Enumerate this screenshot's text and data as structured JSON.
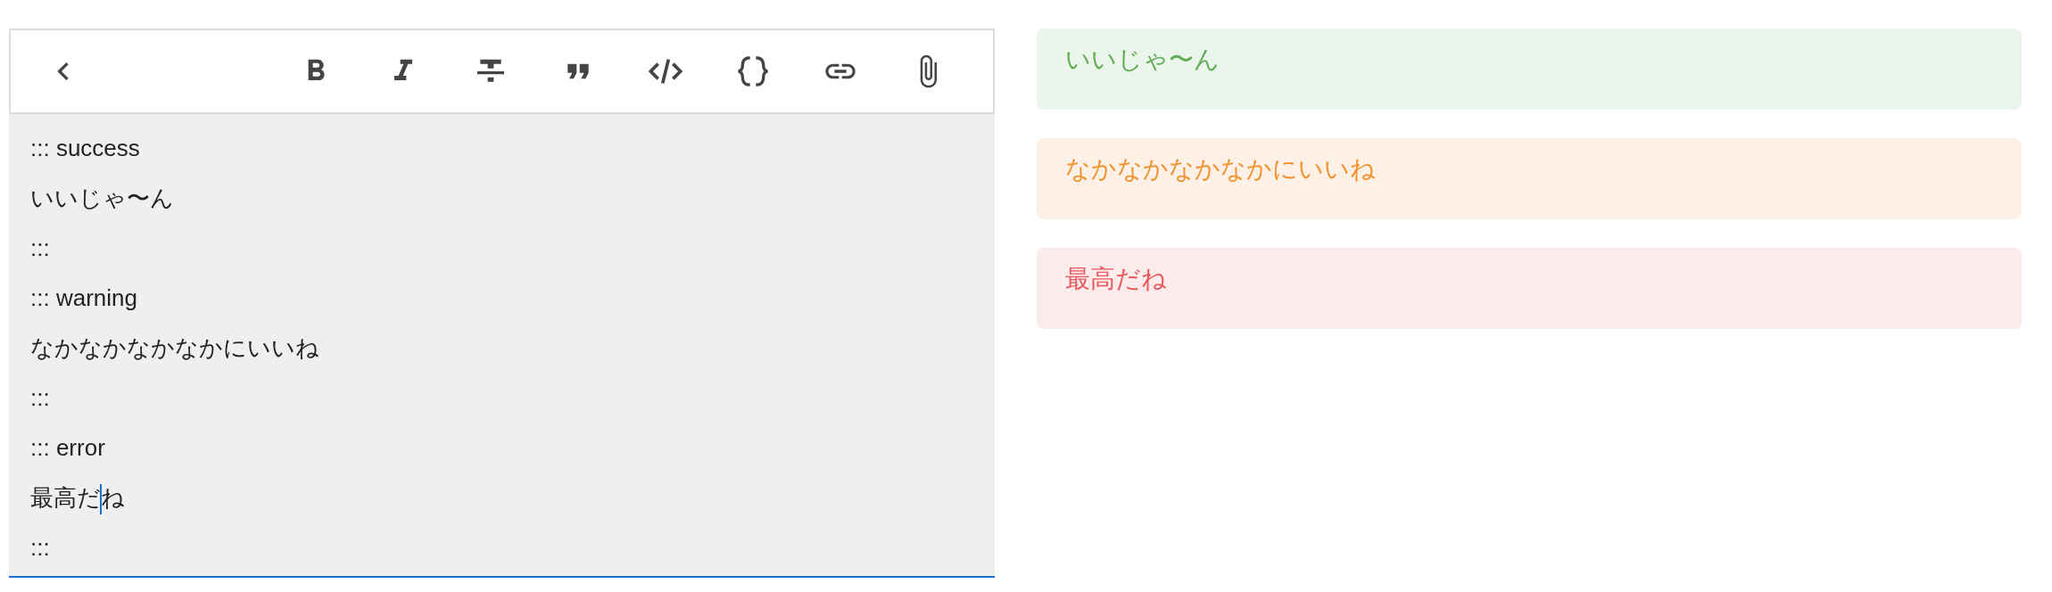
{
  "editor": {
    "lines": [
      {
        "text": "::: success"
      },
      {
        "text": "いいじゃ〜ん"
      },
      {
        "text": ":::"
      },
      {
        "text": "::: warning"
      },
      {
        "text": "なかなかなかなかにいいね"
      },
      {
        "text": ":::"
      },
      {
        "text": "::: error"
      },
      {
        "text": "最高だ",
        "text_after_caret": "ね"
      },
      {
        "text": ":::"
      }
    ]
  },
  "preview": {
    "alerts": [
      {
        "kind": "success",
        "text": "いいじゃ〜ん"
      },
      {
        "kind": "warning",
        "text": "なかなかなかなかにいいね"
      },
      {
        "kind": "error",
        "text": "最高だね"
      }
    ]
  }
}
